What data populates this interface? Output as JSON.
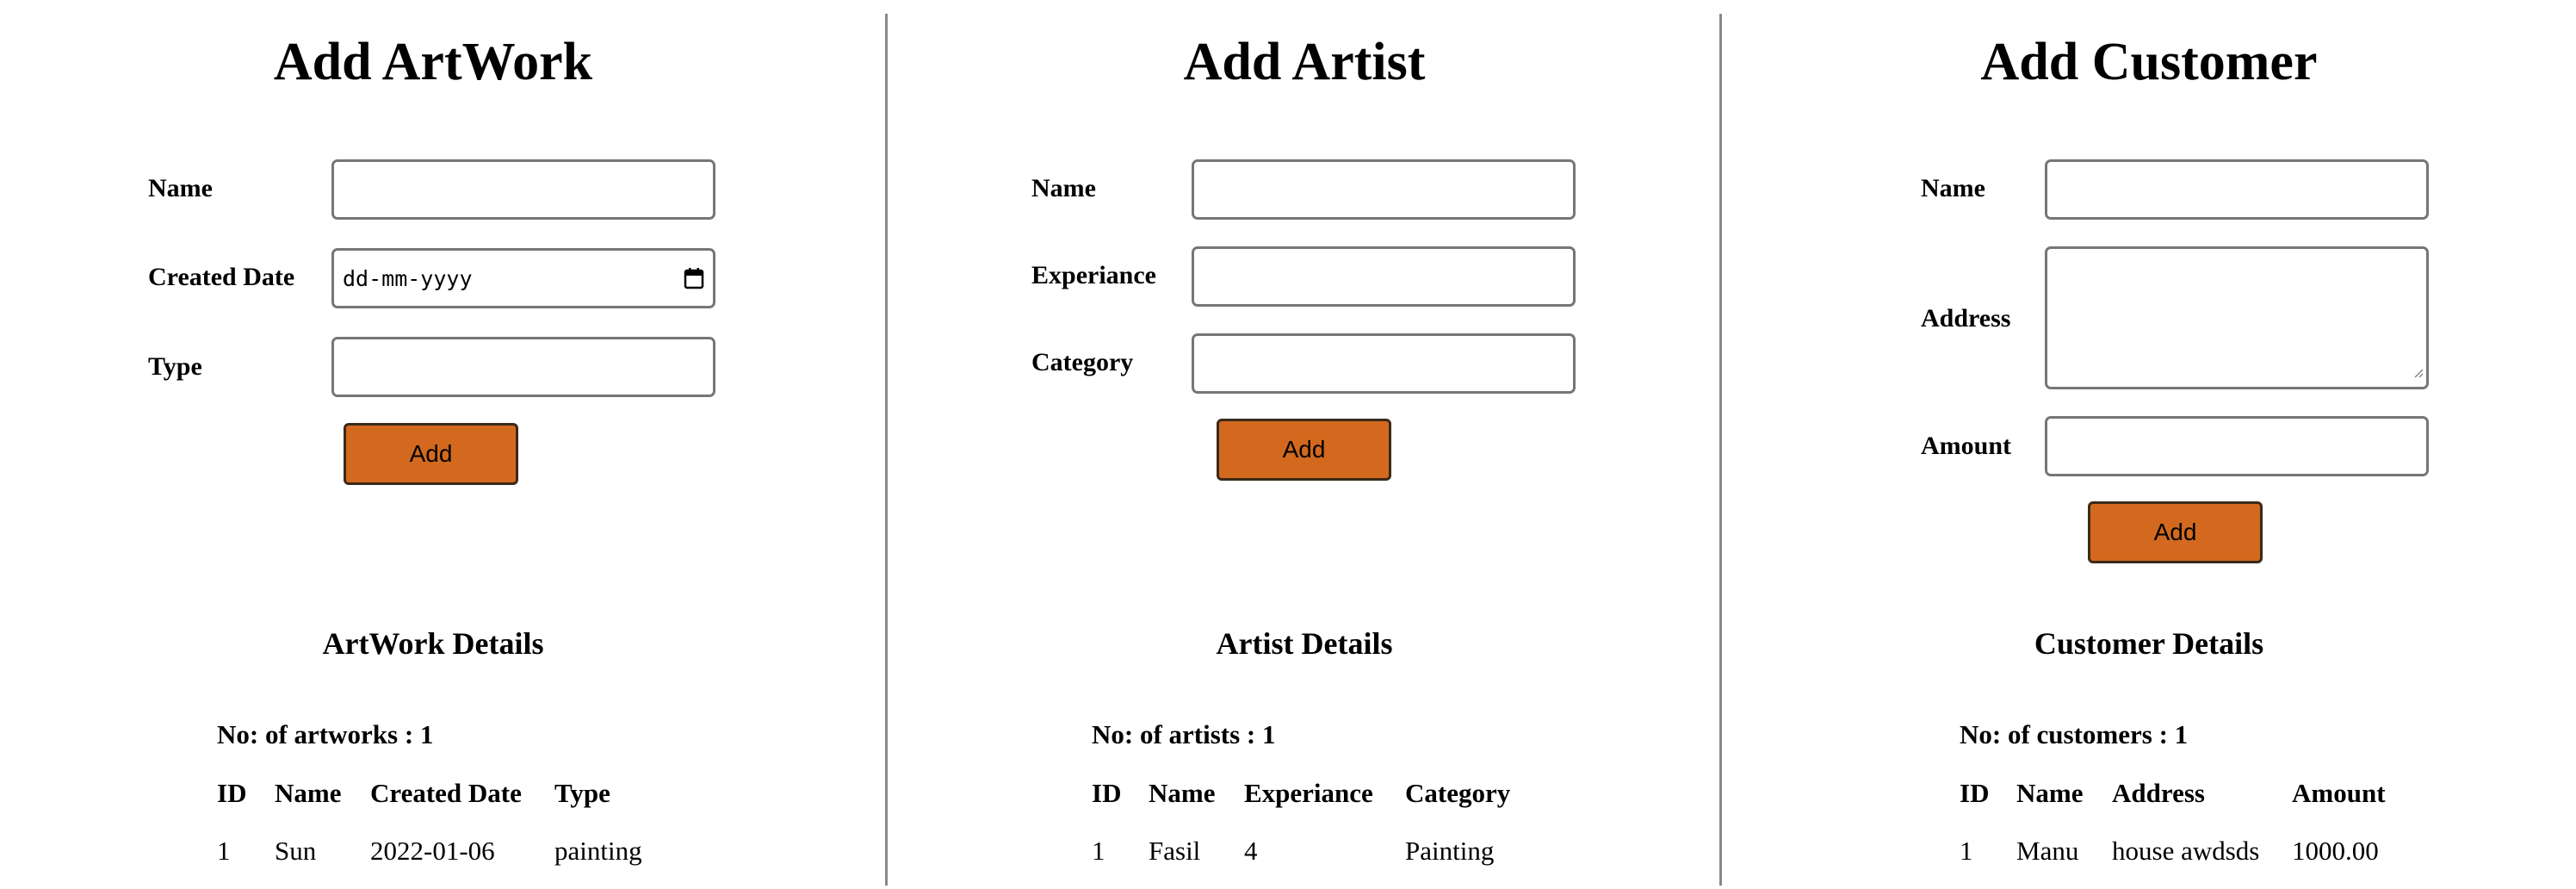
{
  "artwork": {
    "title": "Add ArtWork",
    "form": {
      "name_label": "Name",
      "created_date_label": "Created Date",
      "created_date_placeholder": "dd-mm-yyyy",
      "type_label": "Type",
      "add_label": "Add"
    },
    "details": {
      "title": "ArtWork Details",
      "count_text": "No: of artworks : 1",
      "columns": [
        "ID",
        "Name",
        "Created Date",
        "Type"
      ],
      "rows": [
        [
          "1",
          "Sun",
          "2022-01-06",
          "painting"
        ]
      ]
    }
  },
  "artist": {
    "title": "Add Artist",
    "form": {
      "name_label": "Name",
      "experiance_label": "Experiance",
      "category_label": "Category",
      "add_label": "Add"
    },
    "details": {
      "title": "Artist Details",
      "count_text": "No: of artists : 1",
      "columns": [
        "ID",
        "Name",
        "Experiance",
        "Category"
      ],
      "rows": [
        [
          "1",
          "Fasil",
          "4",
          "Painting"
        ]
      ]
    }
  },
  "customer": {
    "title": "Add Customer",
    "form": {
      "name_label": "Name",
      "address_label": "Address",
      "amount_label": "Amount",
      "add_label": "Add"
    },
    "details": {
      "title": "Customer Details",
      "count_text": "No: of customers : 1",
      "columns": [
        "ID",
        "Name",
        "Address",
        "Amount"
      ],
      "rows": [
        [
          "1",
          "Manu",
          "house awdsds",
          "1000.00"
        ]
      ]
    }
  },
  "colors": {
    "button_bg": "#d2691e",
    "divider": "#888888",
    "field_border": "#767676"
  },
  "icons": {
    "date_picker": "calendar-icon",
    "textarea_resize": "resize-grip-icon"
  }
}
